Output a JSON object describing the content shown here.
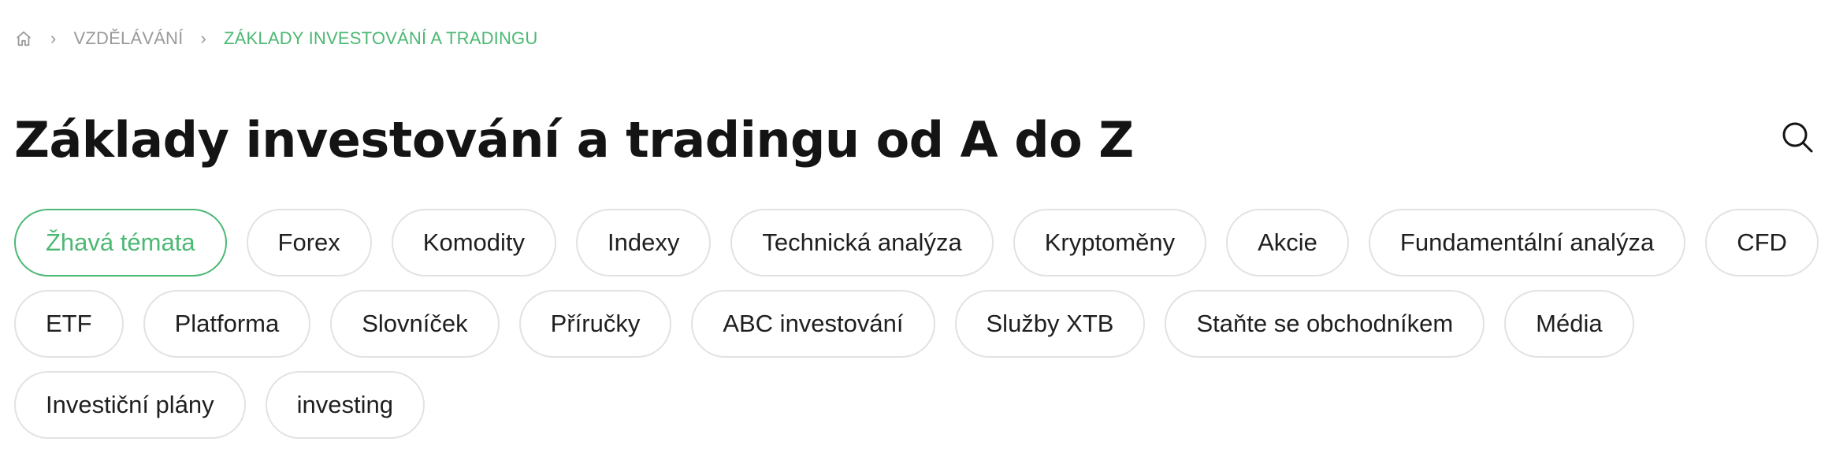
{
  "breadcrumb": {
    "home_icon": "home-icon",
    "items": [
      {
        "label": "VZDĚLÁVÁNÍ"
      },
      {
        "label": "ZÁKLADY INVESTOVÁNÍ A TRADINGU"
      }
    ]
  },
  "header": {
    "title": "Základy investování a tradingu od A do Z",
    "search_icon": "search-icon"
  },
  "colors": {
    "accent": "#4cb873",
    "muted": "#9a9a9a",
    "tag_border": "#e2e2e2",
    "text": "#1c1c1c"
  },
  "tags": [
    {
      "label": "Žhavá témata",
      "active": true
    },
    {
      "label": "Forex",
      "active": false
    },
    {
      "label": "Komodity",
      "active": false
    },
    {
      "label": "Indexy",
      "active": false
    },
    {
      "label": "Technická analýza",
      "active": false
    },
    {
      "label": "Kryptoměny",
      "active": false
    },
    {
      "label": "Akcie",
      "active": false
    },
    {
      "label": "Fundamentální analýza",
      "active": false
    },
    {
      "label": "CFD",
      "active": false
    },
    {
      "label": "ETF",
      "active": false
    },
    {
      "label": "Platforma",
      "active": false
    },
    {
      "label": "Slovníček",
      "active": false
    },
    {
      "label": "Příručky",
      "active": false
    },
    {
      "label": "ABC investování",
      "active": false
    },
    {
      "label": "Služby XTB",
      "active": false
    },
    {
      "label": "Staňte se obchodníkem",
      "active": false
    },
    {
      "label": "Média",
      "active": false
    },
    {
      "label": "Investiční plány",
      "active": false
    },
    {
      "label": "investing",
      "active": false
    }
  ]
}
